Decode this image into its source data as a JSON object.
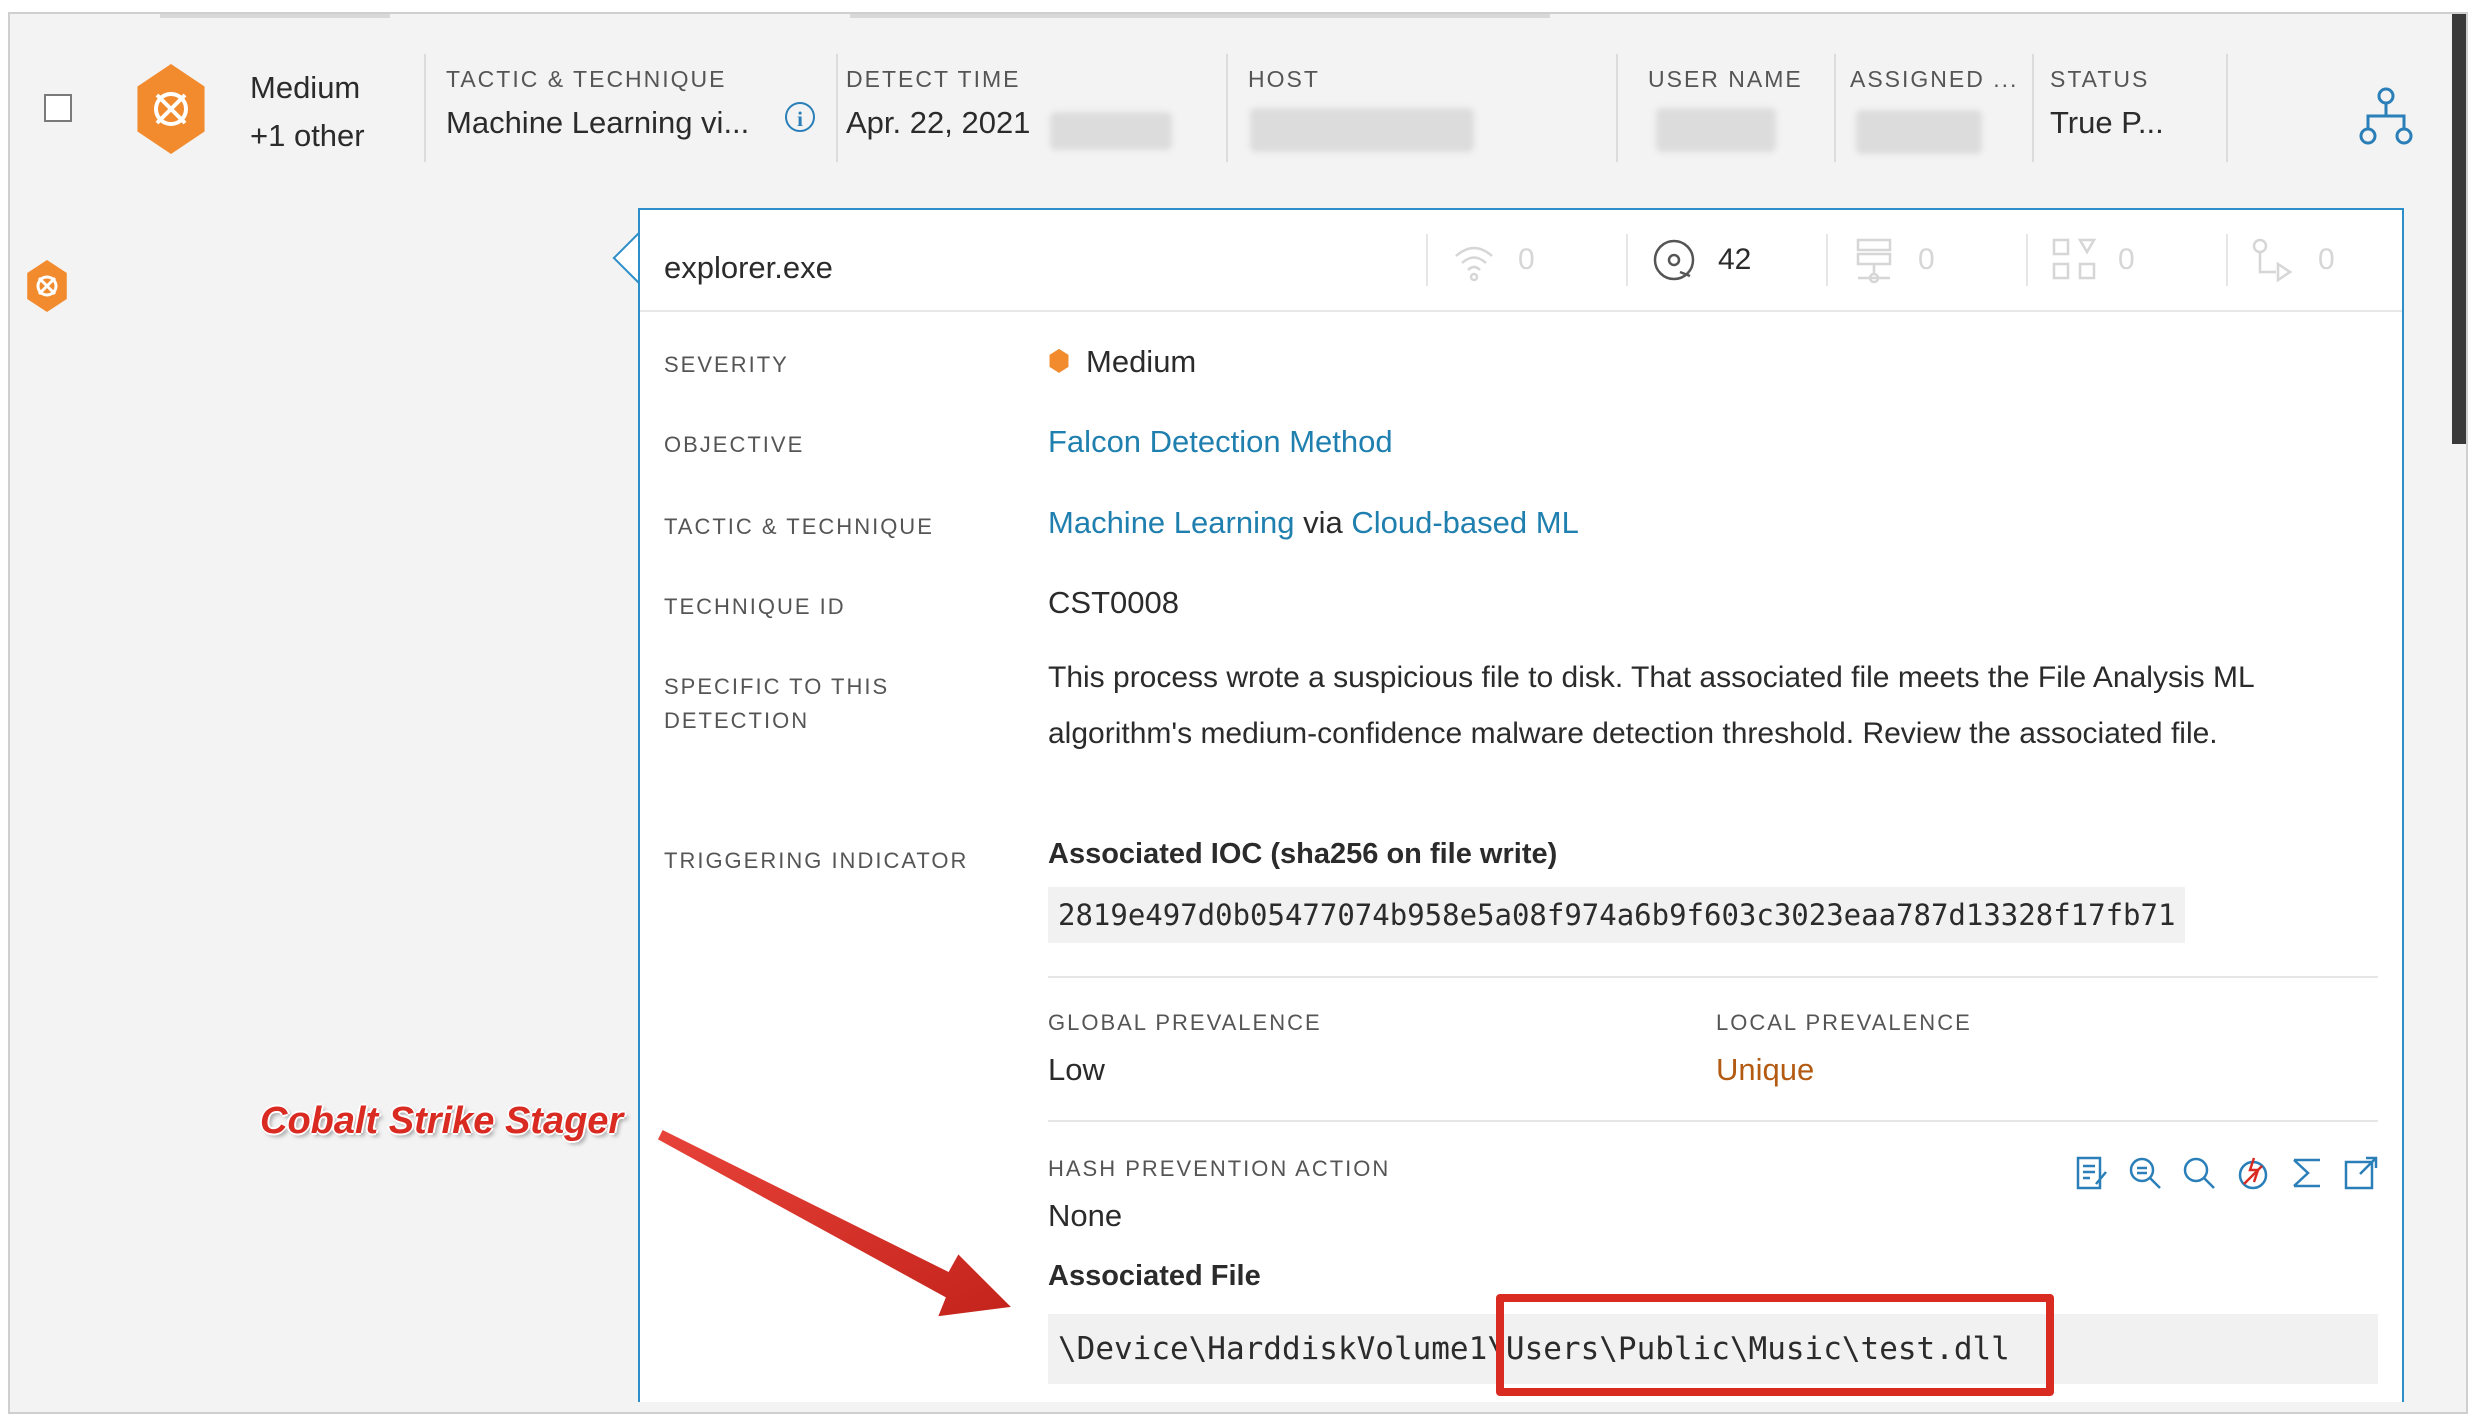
{
  "header": {
    "severity": "Medium",
    "severity_extra": "+1 other",
    "columns": [
      {
        "label": "TACTIC & TECHNIQUE",
        "value": "Machine Learning vi..."
      },
      {
        "label": "DETECT TIME",
        "value": "Apr. 22, 2021"
      },
      {
        "label": "HOST",
        "value": ""
      },
      {
        "label": "USER NAME",
        "value": ""
      },
      {
        "label": "ASSIGNED ...",
        "value": ""
      },
      {
        "label": "STATUS",
        "value": "True P..."
      }
    ]
  },
  "panel": {
    "process": "explorer.exe",
    "stats": [
      {
        "icon": "network-icon",
        "value": "0"
      },
      {
        "icon": "disk-icon",
        "value": "42"
      },
      {
        "icon": "registry-icon",
        "value": "0"
      },
      {
        "icon": "modules-icon",
        "value": "0"
      },
      {
        "icon": "process-tree-icon",
        "value": "0"
      }
    ],
    "labels": {
      "severity": "SEVERITY",
      "objective": "OBJECTIVE",
      "tactic": "TACTIC & TECHNIQUE",
      "technique_id": "TECHNIQUE ID",
      "specific_1": "SPECIFIC TO THIS",
      "specific_2": "DETECTION",
      "triggering": "TRIGGERING INDICATOR"
    },
    "severity": "Medium",
    "objective": "Falcon Detection Method",
    "tactic": "Machine Learning",
    "tactic_via": "via",
    "technique": "Cloud-based ML",
    "technique_id": "CST0008",
    "specific_text": "This process wrote a suspicious file to disk. That associated file meets the File Analysis ML algorithm's medium-confidence malware detection threshold. Review the associated file.",
    "ioc_title": "Associated IOC (sha256 on file write)",
    "ioc_hash": "2819e497d0b05477074b958e5a08f974a6b9f603c3023eaa787d13328f17fb71",
    "global_prevalence_label": "GLOBAL PREVALENCE",
    "global_prevalence": "Low",
    "local_prevalence_label": "LOCAL PREVALENCE",
    "local_prevalence": "Unique",
    "hash_action_label": "HASH PREVENTION ACTION",
    "hash_action": "None",
    "assoc_file_label": "Associated File",
    "assoc_file": "\\Device\\HarddiskVolume1\\Users\\Public\\Music\\test.dll",
    "tools": [
      "notes-icon",
      "zoom-search-icon",
      "search-icon",
      "block-icon",
      "sum-icon",
      "external-link-icon"
    ]
  },
  "annotation": {
    "callout": "Cobalt Strike Stager"
  },
  "colors": {
    "accent": "#2d8fc9",
    "link": "#1f7fae",
    "severity_medium": "#f28a2e",
    "unique": "#b35b13",
    "annotation_red": "#d92b22"
  }
}
